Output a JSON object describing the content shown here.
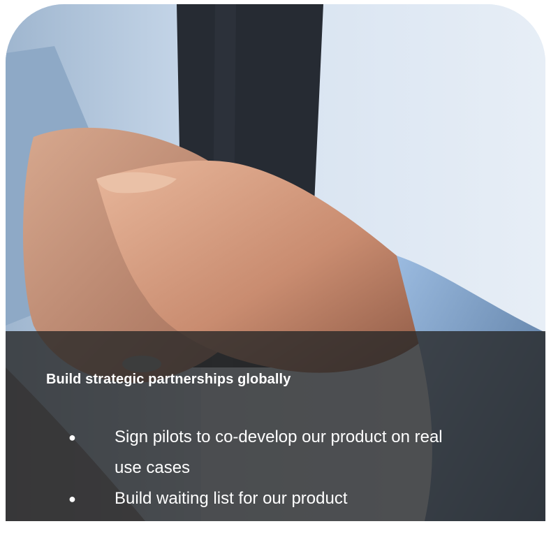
{
  "card": {
    "image": "handshake-photo",
    "headline": "Build strategic partnerships globally",
    "bullets": [
      {
        "text": "Sign pilots to co-develop our product on real use cases"
      },
      {
        "text": "Build waiting list for our product"
      }
    ]
  }
}
